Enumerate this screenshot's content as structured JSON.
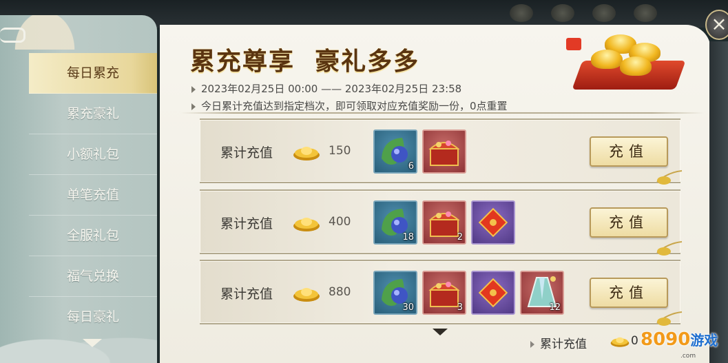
{
  "sidebar": {
    "items": [
      {
        "label": "每日累充",
        "active": true
      },
      {
        "label": "累充豪礼",
        "active": false
      },
      {
        "label": "小额礼包",
        "active": false
      },
      {
        "label": "单笔充值",
        "active": false
      },
      {
        "label": "全服礼包",
        "active": false
      },
      {
        "label": "福气兑换",
        "active": false
      },
      {
        "label": "每日豪礼",
        "active": false
      }
    ],
    "more_icon": "chevron-down-icon"
  },
  "header": {
    "title": "累充尊享  豪礼多多",
    "period": "2023年02月25日 00:00 —— 2023年02月25日 23:58",
    "description": "今日累计充值达到指定档次，即可领取对应充值奖励一份，0点重置"
  },
  "rows": [
    {
      "label": "累计充值",
      "amount": "150",
      "button": "充值",
      "items": [
        {
          "icon": "jade-orb-icon",
          "color": "blue",
          "count": "6"
        },
        {
          "icon": "treasure-chest-icon",
          "color": "red",
          "count": ""
        }
      ]
    },
    {
      "label": "累计充值",
      "amount": "400",
      "button": "充值",
      "items": [
        {
          "icon": "jade-orb-icon",
          "color": "blue",
          "count": "18"
        },
        {
          "icon": "treasure-chest-icon",
          "color": "red",
          "count": "2"
        },
        {
          "icon": "fortune-card-icon",
          "color": "purple",
          "count": ""
        }
      ]
    },
    {
      "label": "累计充值",
      "amount": "880",
      "button": "充值",
      "items": [
        {
          "icon": "jade-orb-icon",
          "color": "blue",
          "count": "30"
        },
        {
          "icon": "treasure-chest-icon",
          "color": "red",
          "count": "3"
        },
        {
          "icon": "fortune-card-icon",
          "color": "purple",
          "count": ""
        },
        {
          "icon": "costume-robe-icon",
          "color": "red",
          "count": "12"
        }
      ]
    }
  ],
  "footer": {
    "label": "累计充值",
    "value": "0"
  },
  "watermark": {
    "brand": "8090",
    "brand_cn": "游戏",
    "domain": ".com"
  },
  "close_icon": "close-icon",
  "colors": {
    "accent_gold": "#eedca3",
    "title_brown": "#5a3410",
    "sidebar_teal": "#bccbc7",
    "active_tab": "#e8d79b"
  }
}
